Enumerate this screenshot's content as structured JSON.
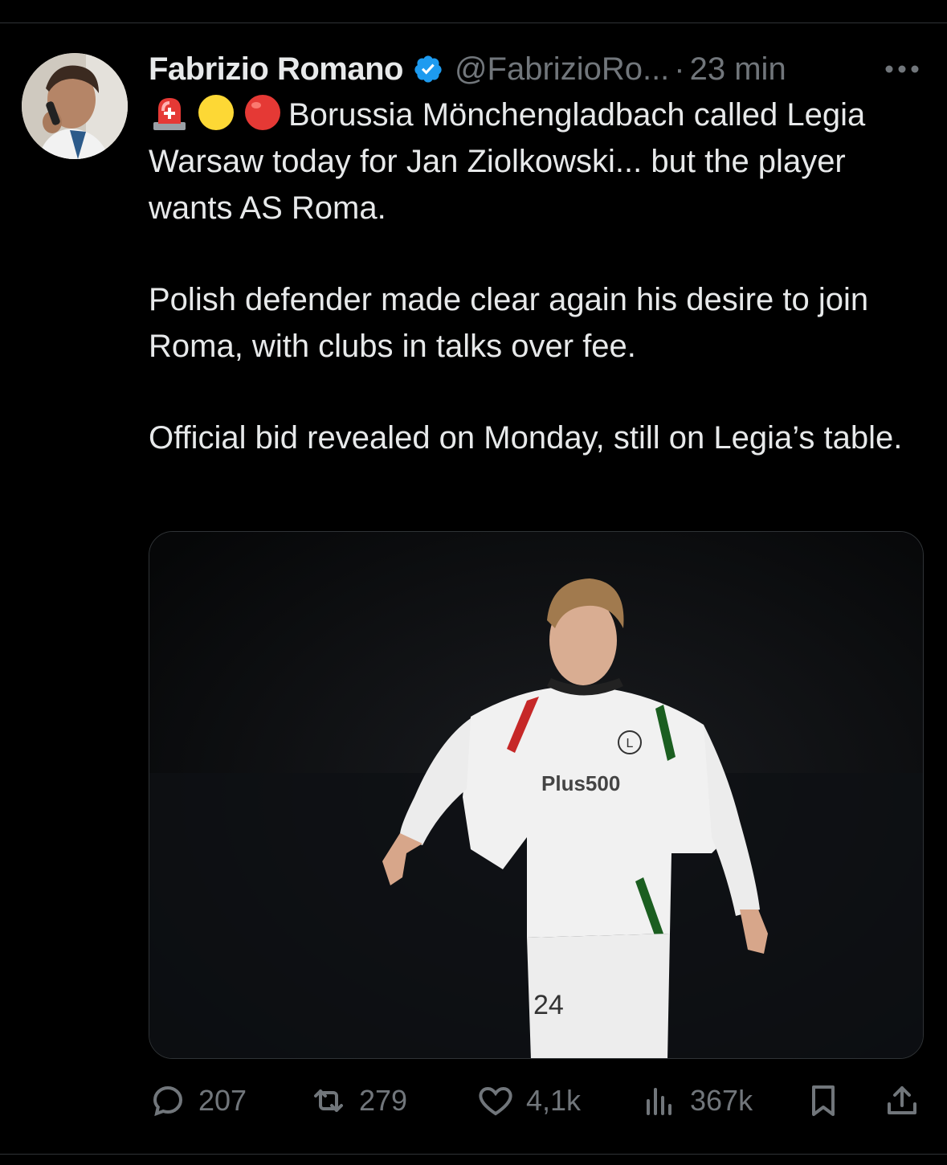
{
  "author": {
    "name": "Fabrizio Romano",
    "handle": "@FabrizioRo...",
    "separator": "·",
    "time": "23 min",
    "verified": true
  },
  "tweet": {
    "emojis": [
      "rotating-light-emoji",
      "yellow-circle-emoji",
      "red-circle-emoji"
    ],
    "paragraph1": "Borussia Mönchengladbach called Legia Warsaw today for Jan Ziolkowski... but the player wants AS Roma.",
    "paragraph2": "Polish defender made clear again his desire to join Roma, with clubs in talks over fee.",
    "paragraph3": "Official bid revealed on Monday, still on Legia’s table."
  },
  "media": {
    "jersey_sponsor": "Plus500",
    "shorts_number": "24"
  },
  "actions": {
    "replies": "207",
    "reposts": "279",
    "likes": "4,1k",
    "views": "367k"
  },
  "colors": {
    "background": "#000000",
    "text": "#e7e9ea",
    "secondary": "#71767b",
    "verified": "#1d9bf0",
    "divider": "#2f3336"
  }
}
